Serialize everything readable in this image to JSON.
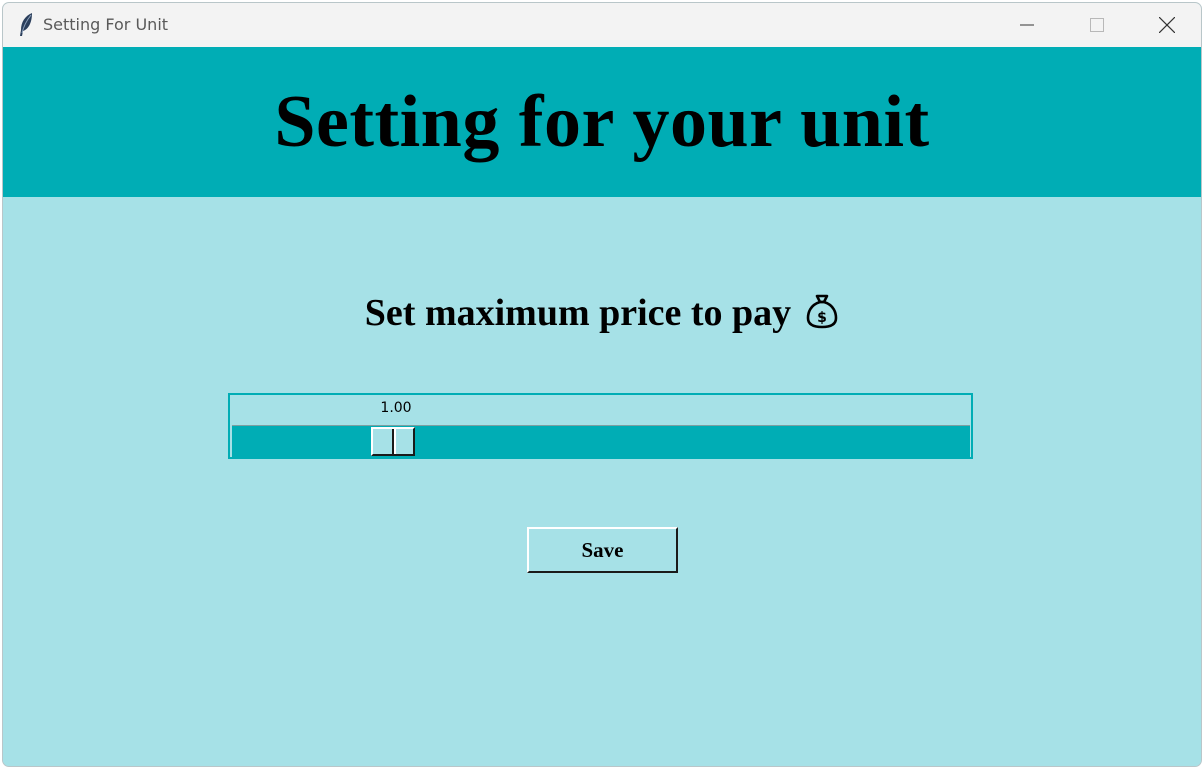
{
  "window": {
    "title": "Setting For Unit",
    "app_icon": "feather-icon",
    "controls": [
      "minimize-icon",
      "maximize-icon",
      "close-icon"
    ]
  },
  "banner": {
    "title": "Setting for your unit"
  },
  "main": {
    "heading": "Set maximum price to pay",
    "heading_icon": "money-bag-icon",
    "slider": {
      "value_label": "1.00",
      "value": 1.0
    },
    "save_label": "Save"
  },
  "colors": {
    "banner": "#00adb5",
    "background": "#a6e1e7",
    "titlebar": "#f3f3f3"
  }
}
